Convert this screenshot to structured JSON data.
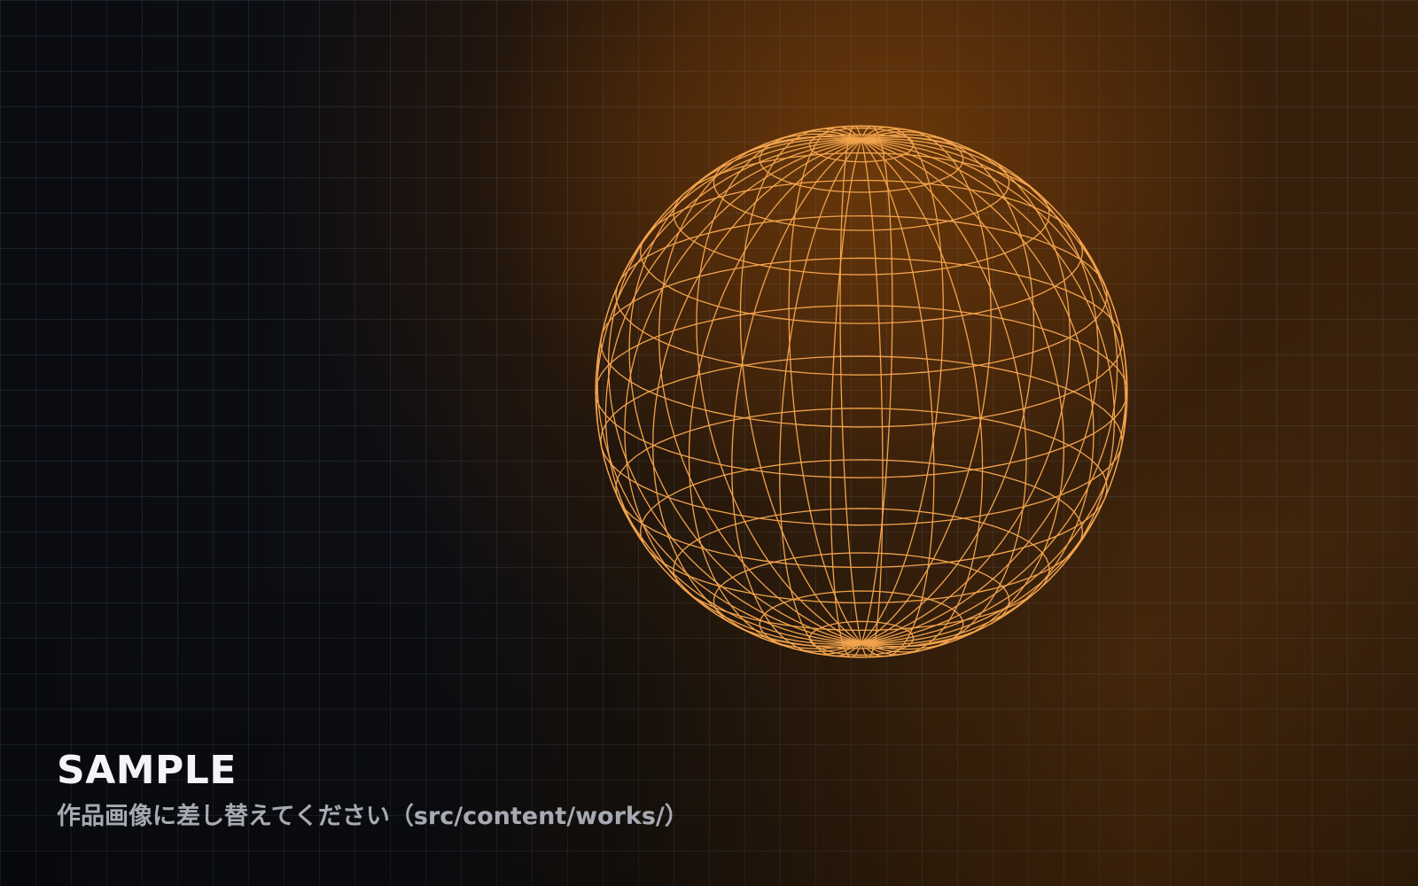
{
  "caption": {
    "title": "SAMPLE",
    "subtitle": "作品画像に差し替えてください（src/content/works/）"
  },
  "sphere": {
    "icon": "wireframe-globe-icon",
    "stroke_color": "#f2a34c"
  },
  "theme": {
    "background": "#0b0d12",
    "glow": "#6e3a0a",
    "grid_line": "#2a2f3a"
  }
}
